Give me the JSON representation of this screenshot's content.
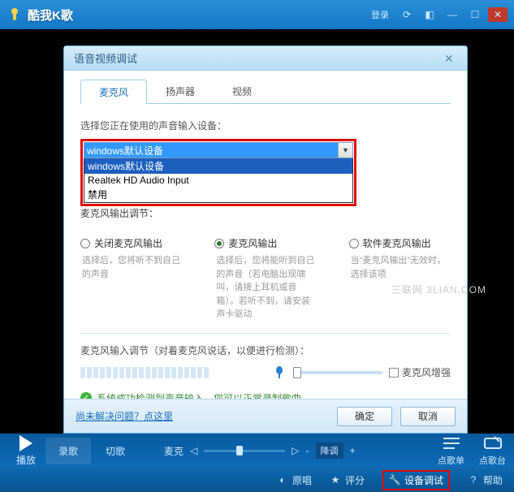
{
  "app": {
    "title": "酷我K歌",
    "login": "登录"
  },
  "dialog": {
    "title": "语音视频调试",
    "tabs": {
      "mic": "麦克风",
      "speaker": "扬声器",
      "video": "视频"
    },
    "device_label": "选择您正在使用的声音输入设备：",
    "combo": {
      "selected": "windows默认设备",
      "options": [
        "windows默认设备",
        "Realtek HD Audio Input",
        "禁用"
      ]
    },
    "partial_hidden": "麦克风输出调节：",
    "radios": {
      "off": {
        "label": "关闭麦克风输出",
        "desc": "选择后，您将听不到自己的声音"
      },
      "on": {
        "label": "麦克风输出",
        "desc": "选择后，您将能听到自己的声音（若电脑出现啸叫，请接上耳机或音箱）。若听不到，请安装声卡驱动"
      },
      "soft": {
        "label": "软件麦克风输出",
        "desc": "当“麦克风输出”无效时，选择该项"
      }
    },
    "vol_label": "麦克风输入调节（对着麦克风说话，以便进行检测）：",
    "boost": "麦克风增强",
    "status": "系统成功检测到声音输入，您可以正常录制歌曲。",
    "help": "尚未解决问题？点这里",
    "ok": "确定",
    "cancel": "取消"
  },
  "watermark": "三联网 3LIAN.COM",
  "bottom": {
    "play": "播放",
    "record": "录歌",
    "cut": "切歌",
    "mic": "麦克",
    "key_minus": "-",
    "key_label": "降调",
    "key_plus": "+",
    "songlist": "点歌单",
    "songdesk": "点歌台",
    "original": "原唱",
    "score": "评分",
    "device": "设备调试",
    "help": "帮助"
  }
}
